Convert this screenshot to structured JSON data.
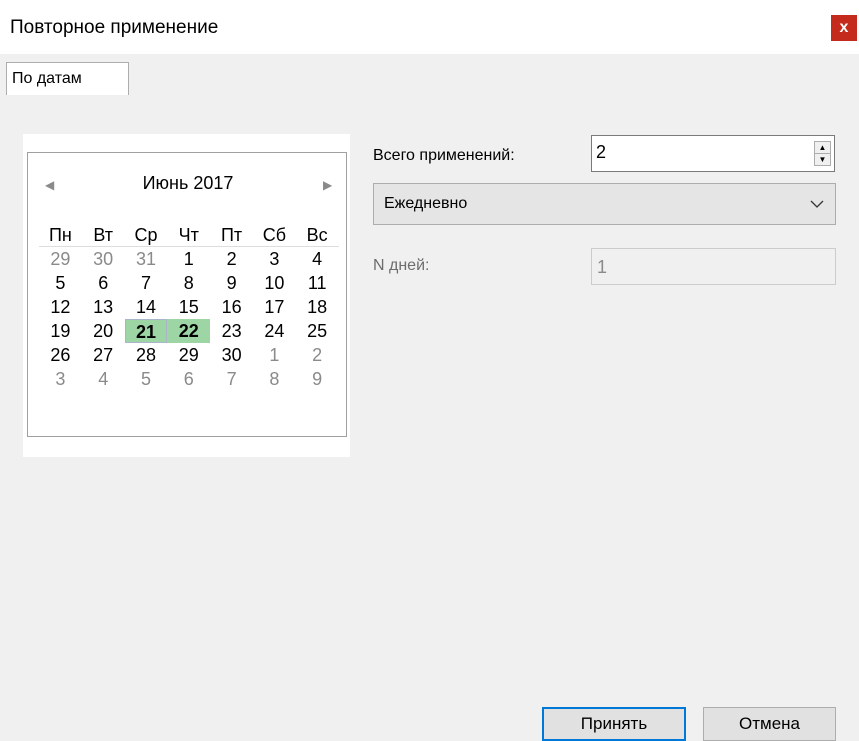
{
  "window": {
    "title": "Повторное применение",
    "close_label": "x"
  },
  "tabs": [
    {
      "label": "По датам",
      "active": true
    }
  ],
  "calendar": {
    "prev_glyph": "◀",
    "next_glyph": "▶",
    "month_label": "Июнь 2017",
    "weekdays": [
      "Пн",
      "Вт",
      "Ср",
      "Чт",
      "Пт",
      "Сб",
      "Вс"
    ],
    "weeks": [
      [
        {
          "d": "29",
          "other": true
        },
        {
          "d": "30",
          "other": true
        },
        {
          "d": "31",
          "other": true
        },
        {
          "d": "1"
        },
        {
          "d": "2"
        },
        {
          "d": "3"
        },
        {
          "d": "4"
        }
      ],
      [
        {
          "d": "5"
        },
        {
          "d": "6"
        },
        {
          "d": "7"
        },
        {
          "d": "8"
        },
        {
          "d": "9"
        },
        {
          "d": "10"
        },
        {
          "d": "11"
        }
      ],
      [
        {
          "d": "12"
        },
        {
          "d": "13"
        },
        {
          "d": "14"
        },
        {
          "d": "15"
        },
        {
          "d": "16"
        },
        {
          "d": "17"
        },
        {
          "d": "18"
        }
      ],
      [
        {
          "d": "19"
        },
        {
          "d": "20"
        },
        {
          "d": "21",
          "selected": true,
          "first": true
        },
        {
          "d": "22",
          "selected": true
        },
        {
          "d": "23"
        },
        {
          "d": "24"
        },
        {
          "d": "25"
        }
      ],
      [
        {
          "d": "26"
        },
        {
          "d": "27"
        },
        {
          "d": "28"
        },
        {
          "d": "29"
        },
        {
          "d": "30"
        },
        {
          "d": "1",
          "other": true
        },
        {
          "d": "2",
          "other": true
        }
      ],
      [
        {
          "d": "3",
          "other": true
        },
        {
          "d": "4",
          "other": true
        },
        {
          "d": "5",
          "other": true
        },
        {
          "d": "6",
          "other": true
        },
        {
          "d": "7",
          "other": true
        },
        {
          "d": "8",
          "other": true
        },
        {
          "d": "9",
          "other": true
        }
      ]
    ],
    "selection_color": "#9dd5a4"
  },
  "form": {
    "total_label": "Всего применений:",
    "total_value": "2",
    "frequency_value": "Ежедневно",
    "ndays_label": "N дней:",
    "ndays_value": "1"
  },
  "buttons": {
    "accept": "Принять",
    "cancel": "Отмена"
  },
  "colors": {
    "close_bg": "#c42b1c",
    "accent": "#0078d7"
  }
}
